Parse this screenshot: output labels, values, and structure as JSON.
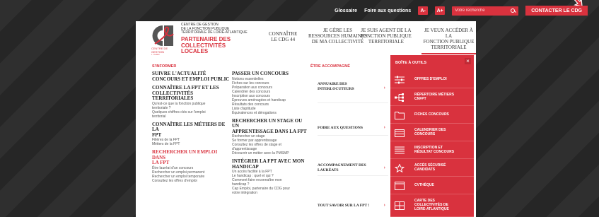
{
  "utility": {
    "links": [
      "Glossaire",
      "Foire aux questions"
    ],
    "font_decrease": "A-",
    "font_increase": "A+",
    "search_placeholder": "Votre recherche",
    "contact": "CONTACTER LE CDG"
  },
  "header": {
    "org_name": [
      "CENTRE DE GESTION",
      "DE LA FONCTION PUBLIQUE",
      "TERRITORIALE DE LOIRE-ATLANTIQUE"
    ],
    "org_tagline": [
      "PARTENAIRE DES",
      "COLLECTIVITÉS",
      "LOCALES"
    ],
    "logo_caption": [
      "CENTRE DE GESTION",
      "LOIRE-ATLANTIQUE"
    ],
    "nav": [
      {
        "label": [
          "CONNAÎTRE",
          "LE CDG 44"
        ]
      },
      {
        "label": [
          "JE GÈRE LES",
          "RESSOURCES HUMAINES",
          "DE MA COLLECTIVITÉ"
        ]
      },
      {
        "label": [
          "JE SUIS AGENT DE LA",
          "FONCTION PUBLIQUE",
          "TERRITORIALE"
        ]
      },
      {
        "label": [
          "JE VEUX ACCÉDER À LA",
          "FONCTION PUBLIQUE",
          "TERRITORIALE"
        ],
        "active": true
      }
    ]
  },
  "menu": {
    "inform_head": "S'INFORMER",
    "col1": [
      {
        "title": [
          "SUIVRE L'ACTUALITÉ",
          "CONCOURS ET EMPLOI PUBLIC"
        ],
        "links": []
      },
      {
        "title": [
          "CONNAÎTRE LA FPT ET LES",
          "COLLECTIVITÉS TERRITORIALES"
        ],
        "links": [
          "Qu'est-ce que la fonction publique",
          "territoriale ?",
          "Quelques chiffres clés sur l'emploi",
          "territorial"
        ]
      },
      {
        "title": [
          "CONNAÎTRE LES MÉTIERS DE LA",
          "FPT"
        ],
        "links": [
          "Filières de la FPT",
          "Métiers de la FPT"
        ]
      },
      {
        "title": [
          "RECHERCHER UN EMPLOI DANS",
          "LA FPT"
        ],
        "red": true,
        "links": [
          "Être lauréat d'un concours",
          "Rechercher un emploi permanent",
          "Rechercher un emploi temporaire",
          "Consultez les offres d'emploi"
        ]
      }
    ],
    "col2": [
      {
        "title": [
          "PASSER UN CONCOURS"
        ],
        "links": [
          "Notions essentielles",
          "Fiches sur les concours",
          "Préparation aux concours",
          "Calendrier des concours",
          "Inscription aux concours",
          "Épreuves aménagées et handicap",
          "Résultats des concours",
          "Liste d'aptitude",
          "Équivalences et dérogations"
        ]
      },
      {
        "title": [
          "RECHERCHER UN STAGE OU UN",
          "APPRENTISSAGE DANS LA FPT"
        ],
        "links": [
          "Rechercher un stage",
          "Se former par apprentissage",
          "Consultez les offres de stage et",
          "d'apprentissage",
          "Découvrir un métier avec la PMSMP"
        ]
      },
      {
        "title": [
          "INTÉGRER LA FPT AVEC MON",
          "HANDICAP"
        ],
        "links": [
          "Un accès facilité à la FPT",
          "Le handicap : quel et qui ?",
          "Comment faire reconnaître mon",
          "handicap ?",
          "Cap Emploi, partenaire du CDG pour",
          "votre intégration"
        ]
      }
    ],
    "accomp_head": "ÊTRE ACCOMPAGNÉ",
    "accomp": [
      {
        "label": [
          "ANNUAIRE DES",
          "INTERLOCUTEURS"
        ]
      },
      {
        "label": [
          "FOIRE AUX QUESTIONS"
        ]
      },
      {
        "label": [
          "ACCOMPAGNEMENT DES",
          "LAURÉATS"
        ]
      },
      {
        "label": [
          "TOUT SAVOIR SUR LA FPT !"
        ]
      }
    ],
    "arrow": "›"
  },
  "tools": {
    "head": "BOÎTE À OUTILS",
    "close": "×",
    "items": [
      {
        "icon": "sliders-icon",
        "label": [
          "OFFRES D'EMPLOI"
        ]
      },
      {
        "icon": "org-chart-icon",
        "label": [
          "RÉPERTOIRE MÉTIERS",
          "CNFPT"
        ]
      },
      {
        "icon": "folder-icon",
        "label": [
          "FICHES CONCOURS"
        ]
      },
      {
        "icon": "calendar-icon",
        "label": [
          "CALENDRIER DES",
          "CONCOURS"
        ]
      },
      {
        "icon": "list-icon",
        "label": [
          "INSCRIPTION ET",
          "RÉSULTAT CONCOURS"
        ]
      },
      {
        "icon": "star-icon",
        "label": [
          "ACCÈS SÉCURISÉ",
          "CANDIDATS"
        ]
      },
      {
        "icon": "book-icon",
        "label": [
          "CVTHÈQUE"
        ]
      },
      {
        "icon": "map-icon",
        "label": [
          "CARTE DES",
          "COLLECTIVITÉS DE",
          "LOIRE-ATLANTIQUE"
        ]
      }
    ]
  }
}
